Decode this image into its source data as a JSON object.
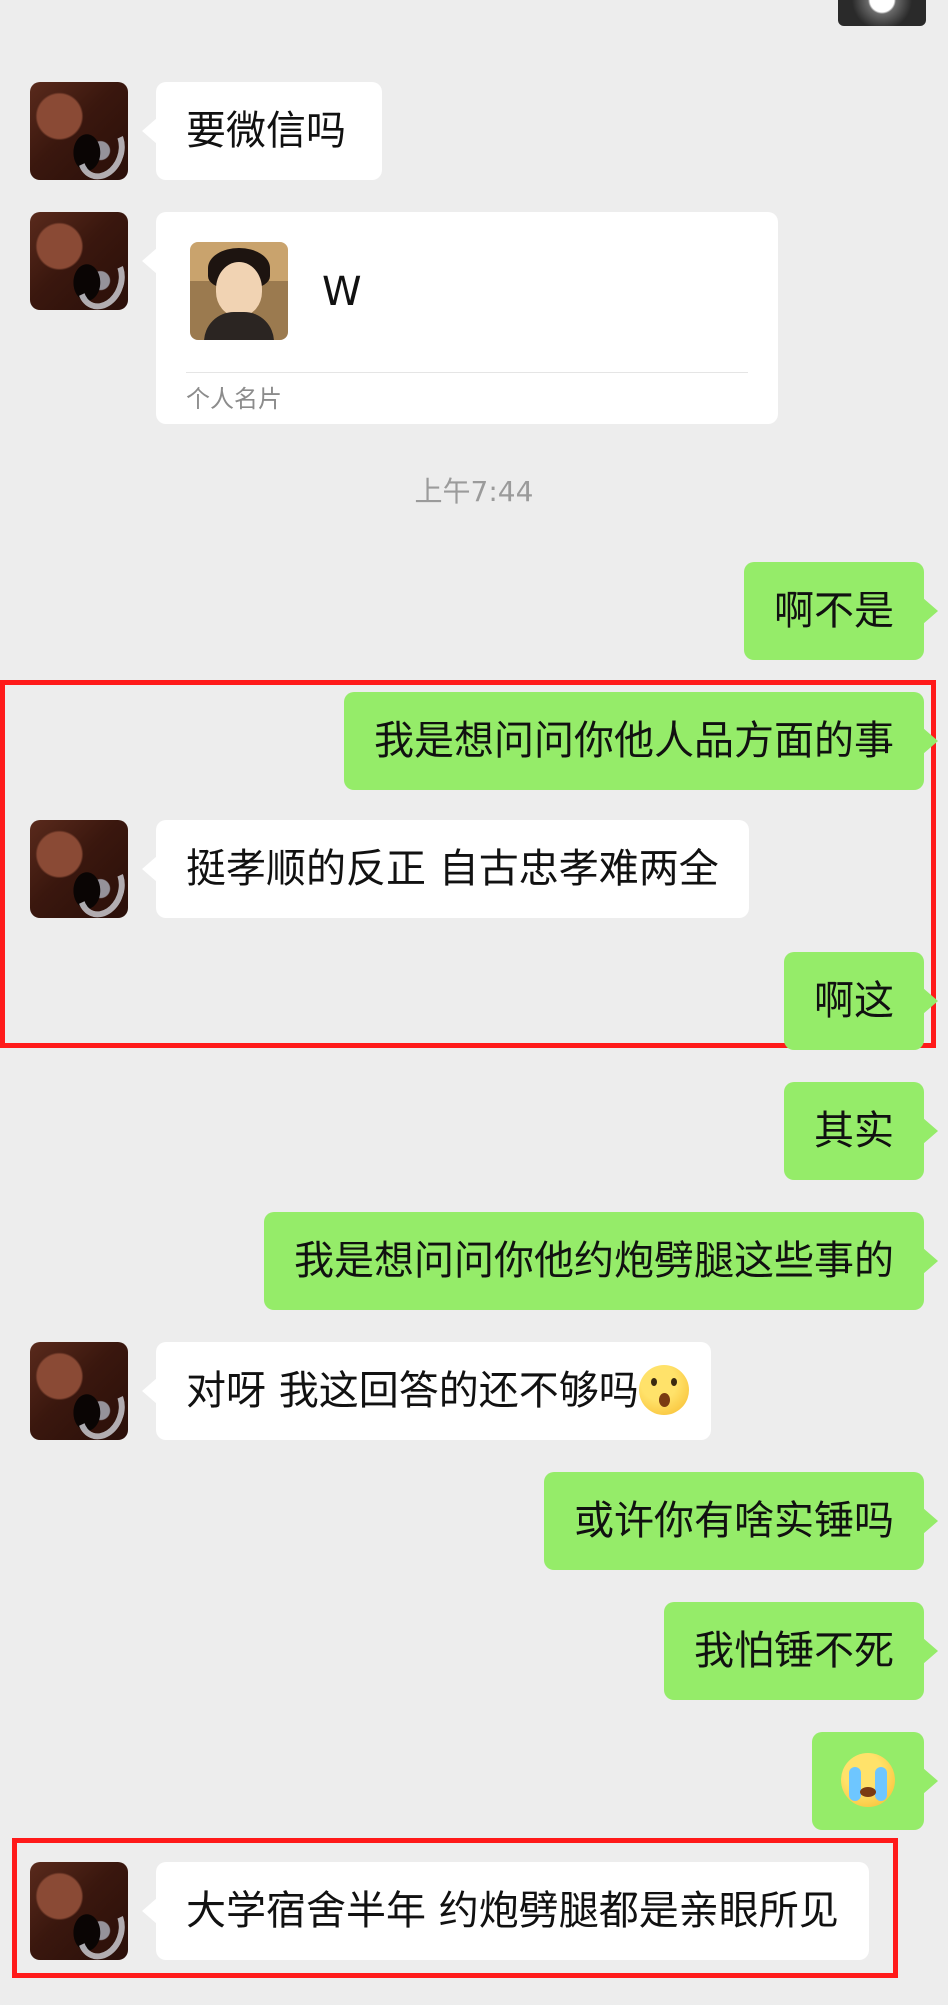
{
  "conversation": {
    "timestamp": "上午7:44",
    "messages": [
      {
        "id": "m1",
        "from": "them",
        "text": "要微信吗"
      },
      {
        "id": "m2",
        "from": "them",
        "type": "contact_card",
        "name": "W",
        "label": "个人名片"
      },
      {
        "id": "m3",
        "from": "me",
        "text": "啊不是"
      },
      {
        "id": "m4",
        "from": "me",
        "text": "我是想问问你他人品方面的事"
      },
      {
        "id": "m5",
        "from": "them",
        "text": "挺孝顺的反正 自古忠孝难两全"
      },
      {
        "id": "m6",
        "from": "me",
        "text": "啊这"
      },
      {
        "id": "m7",
        "from": "me",
        "text": "其实"
      },
      {
        "id": "m8",
        "from": "me",
        "text": "我是想问问你他约炮劈腿这些事的"
      },
      {
        "id": "m9",
        "from": "them",
        "text": "对呀 我这回答的还不够吗",
        "emoji": "shocked-face"
      },
      {
        "id": "m10",
        "from": "me",
        "text": "或许你有啥实锤吗"
      },
      {
        "id": "m11",
        "from": "me",
        "text": "我怕锤不死"
      },
      {
        "id": "m12",
        "from": "me",
        "emoji": "crying-face"
      },
      {
        "id": "m13",
        "from": "them",
        "text": "大学宿舍半年 约炮劈腿都是亲眼所见"
      }
    ]
  },
  "colors": {
    "background": "#ededed",
    "incoming_bubble": "#ffffff",
    "outgoing_bubble": "#95ec69",
    "highlight_box": "#ff1a1a"
  }
}
